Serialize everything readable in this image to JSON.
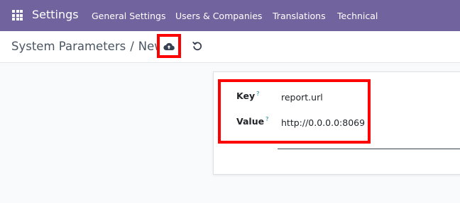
{
  "navbar": {
    "app_name": "Settings",
    "menu": [
      {
        "label": "General Settings"
      },
      {
        "label": "Users & Companies"
      },
      {
        "label": "Translations"
      },
      {
        "label": "Technical"
      }
    ]
  },
  "breadcrumb": {
    "parent": "System Parameters",
    "separator": "/",
    "current": "New"
  },
  "actions": {
    "save_icon": "cloud-upload-icon",
    "discard_icon": "undo-icon"
  },
  "form": {
    "key": {
      "label": "Key",
      "help": "?",
      "value": "report.url"
    },
    "value": {
      "label": "Value",
      "help": "?",
      "value": "http://0.0.0.0:8069"
    }
  },
  "colors": {
    "navbar": "#71639e",
    "highlight": "#ff0000",
    "help_mark": "#017e84"
  }
}
